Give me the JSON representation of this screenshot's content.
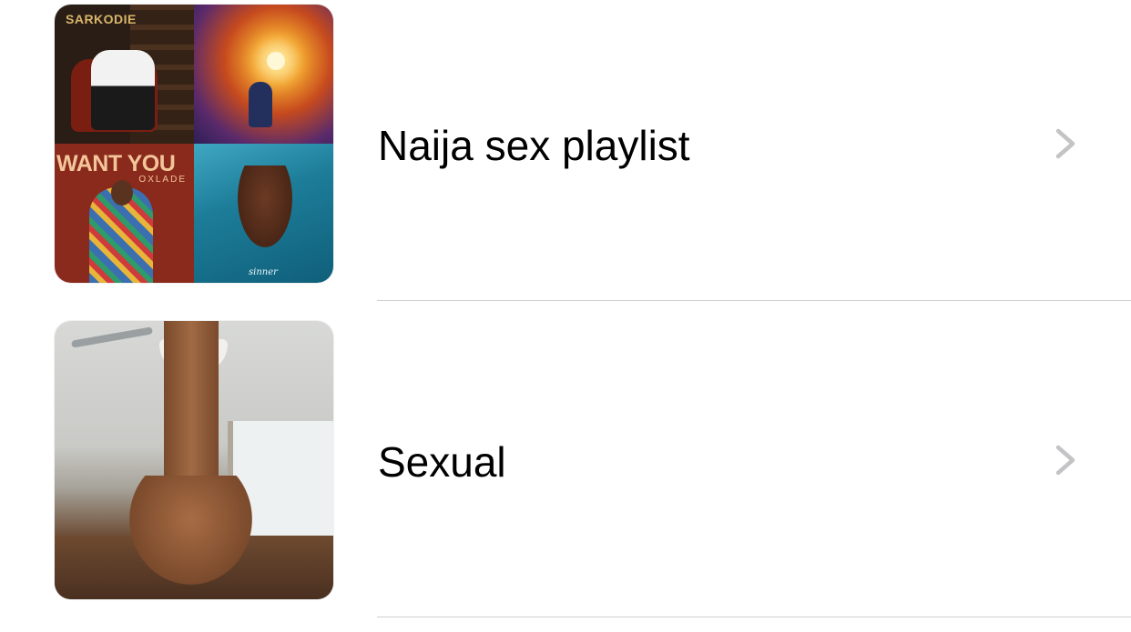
{
  "playlists": [
    {
      "title": "Naija sex playlist",
      "artwork": {
        "type": "mosaic",
        "tiles": [
          {
            "title": "SARKODIE"
          },
          {
            "title": ""
          },
          {
            "title": "WANT YOU",
            "subtitle": "OXLADE"
          },
          {
            "title": "sinner"
          }
        ]
      },
      "chevron": "chevron-right-icon"
    },
    {
      "title": "Sexual",
      "artwork": {
        "type": "single"
      },
      "chevron": "chevron-right-icon"
    }
  ],
  "colors": {
    "background": "#ffffff",
    "text": "#000000",
    "chevron": "#c4c4c7",
    "separator": "#cfcfd3"
  }
}
